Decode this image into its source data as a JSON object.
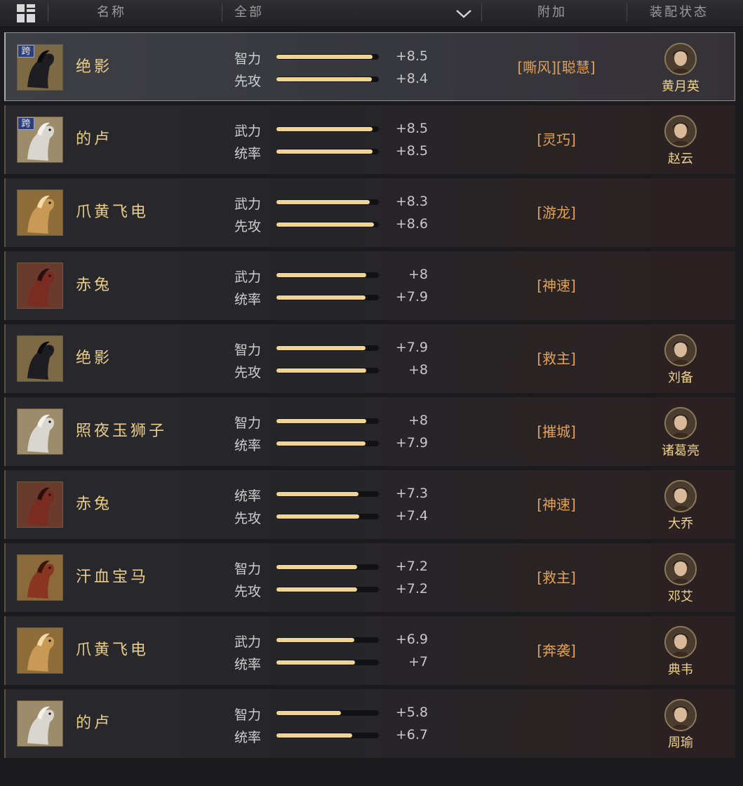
{
  "header": {
    "name_col": "名称",
    "filter_value": "全部",
    "bonus_col": "附加",
    "equip_col": "装配状态"
  },
  "rows": [
    {
      "name": "绝影",
      "cross": "跨",
      "selected": true,
      "horse": "black",
      "stats": [
        {
          "label": "智力",
          "value": "+8.5",
          "pct": 0.94
        },
        {
          "label": "先攻",
          "value": "+8.4",
          "pct": 0.93
        }
      ],
      "bonus": "[嘶风][聪慧]",
      "general": "黄月英",
      "avatar": "female"
    },
    {
      "name": "的卢",
      "cross": "跨",
      "selected": false,
      "horse": "white",
      "stats": [
        {
          "label": "武力",
          "value": "+8.5",
          "pct": 0.94
        },
        {
          "label": "统率",
          "value": "+8.5",
          "pct": 0.94
        }
      ],
      "bonus": "[灵巧]",
      "general": "赵云",
      "avatar": "male"
    },
    {
      "name": "爪黄飞电",
      "cross": "",
      "selected": false,
      "horse": "gold",
      "stats": [
        {
          "label": "武力",
          "value": "+8.3",
          "pct": 0.91
        },
        {
          "label": "先攻",
          "value": "+8.6",
          "pct": 0.95
        }
      ],
      "bonus": "[游龙]",
      "general": "",
      "avatar": ""
    },
    {
      "name": "赤兔",
      "cross": "",
      "selected": false,
      "horse": "red",
      "stats": [
        {
          "label": "武力",
          "value": "+8",
          "pct": 0.88
        },
        {
          "label": "统率",
          "value": "+7.9",
          "pct": 0.87
        }
      ],
      "bonus": "[神速]",
      "general": "",
      "avatar": ""
    },
    {
      "name": "绝影",
      "cross": "",
      "selected": false,
      "horse": "black",
      "stats": [
        {
          "label": "智力",
          "value": "+7.9",
          "pct": 0.87
        },
        {
          "label": "先攻",
          "value": "+8",
          "pct": 0.88
        }
      ],
      "bonus": "[救主]",
      "general": "刘备",
      "avatar": "male"
    },
    {
      "name": "照夜玉狮子",
      "cross": "",
      "selected": false,
      "horse": "white",
      "stats": [
        {
          "label": "智力",
          "value": "+8",
          "pct": 0.88
        },
        {
          "label": "统率",
          "value": "+7.9",
          "pct": 0.87
        }
      ],
      "bonus": "[摧城]",
      "general": "诸葛亮",
      "avatar": "male"
    },
    {
      "name": "赤兔",
      "cross": "",
      "selected": false,
      "horse": "red",
      "stats": [
        {
          "label": "统率",
          "value": "+7.3",
          "pct": 0.8
        },
        {
          "label": "先攻",
          "value": "+7.4",
          "pct": 0.81
        }
      ],
      "bonus": "[神速]",
      "general": "大乔",
      "avatar": "female"
    },
    {
      "name": "汗血宝马",
      "cross": "",
      "selected": false,
      "horse": "chestnut",
      "stats": [
        {
          "label": "智力",
          "value": "+7.2",
          "pct": 0.79
        },
        {
          "label": "先攻",
          "value": "+7.2",
          "pct": 0.79
        }
      ],
      "bonus": "[救主]",
      "general": "邓艾",
      "avatar": "male"
    },
    {
      "name": "爪黄飞电",
      "cross": "",
      "selected": false,
      "horse": "gold",
      "stats": [
        {
          "label": "武力",
          "value": "+6.9",
          "pct": 0.76
        },
        {
          "label": "统率",
          "value": "+7",
          "pct": 0.77
        }
      ],
      "bonus": "[奔袭]",
      "general": "典韦",
      "avatar": "male"
    },
    {
      "name": "的卢",
      "cross": "",
      "selected": false,
      "horse": "white",
      "stats": [
        {
          "label": "智力",
          "value": "+5.8",
          "pct": 0.63
        },
        {
          "label": "统率",
          "value": "+6.7",
          "pct": 0.74
        }
      ],
      "bonus": "",
      "general": "周瑜",
      "avatar": "male"
    }
  ],
  "colors": {
    "bar_fill": "#efd591",
    "bonus_text": "#e2a158",
    "name_text": "#e8cd8a"
  }
}
